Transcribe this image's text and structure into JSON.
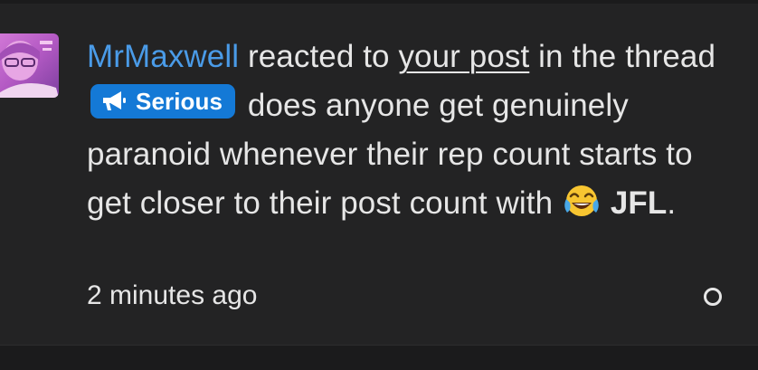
{
  "notification": {
    "user": "MrMaxwell",
    "text_reacted": "reacted to",
    "post_link": "your post",
    "text_in_the": "in the",
    "text_thread": "thread",
    "prefix_label": "Serious",
    "thread_title": "does anyone get genuinely paranoid whenever their rep count starts to get closer to their post count with",
    "reaction_label": "JFL",
    "period": ".",
    "timestamp": "2 minutes ago"
  },
  "icons": {
    "avatar": "user-avatar",
    "prefix_icon": "megaphone-icon",
    "emoji": "tears-of-joy-emoji",
    "mark_read": "circle-icon"
  },
  "colors": {
    "background": "#232324",
    "link": "#4a9be8",
    "prefix_bg": "#1479d6",
    "text": "#e6e6e6"
  }
}
